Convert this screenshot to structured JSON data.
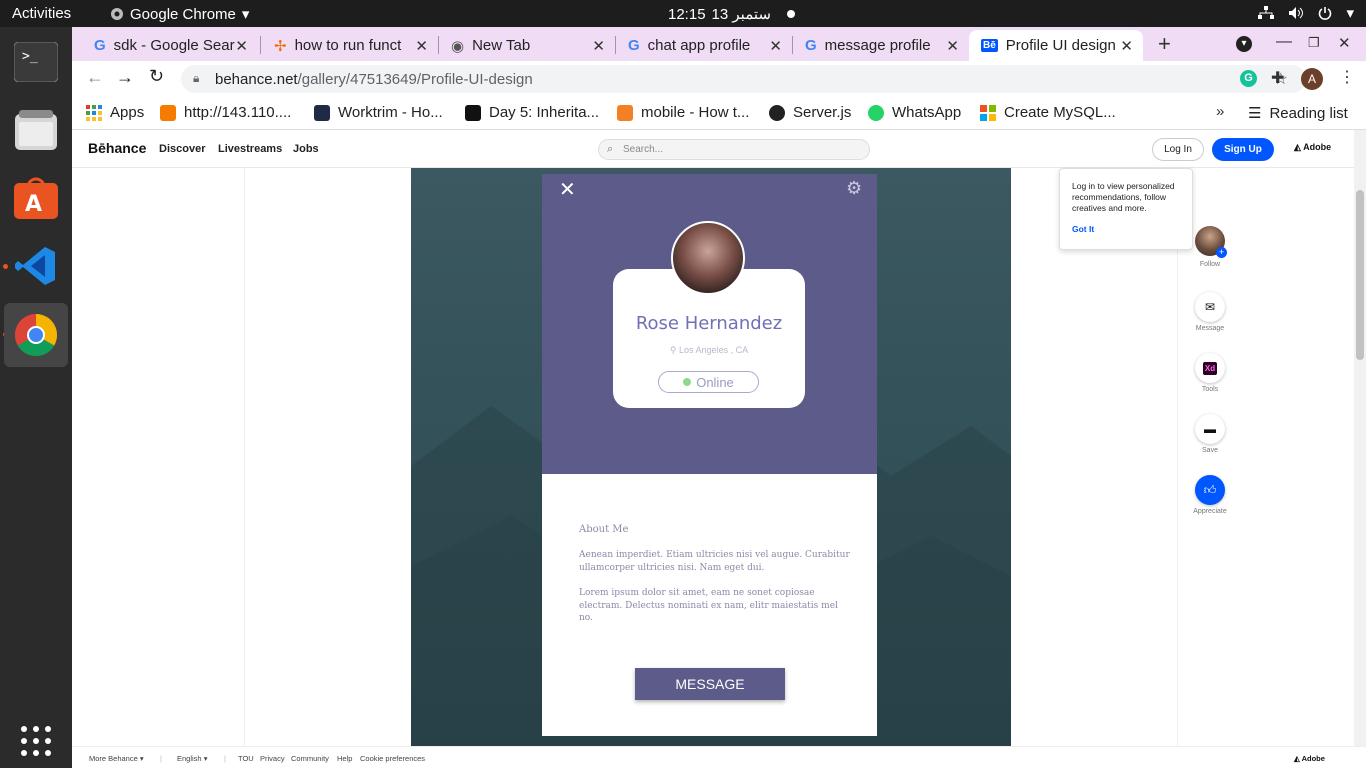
{
  "topbar": {
    "activities": "Activities",
    "app_name": "Google Chrome",
    "time": "12:15",
    "date": "13 ستمبر"
  },
  "dock": {
    "items": [
      "terminal-icon",
      "files-icon",
      "software-icon",
      "vscode-icon",
      "chrome-icon"
    ],
    "apps_grid": "show-apps-icon"
  },
  "tabs": [
    {
      "title": "sdk - Google Sear",
      "icon": "google-icon"
    },
    {
      "title": "how to run funct",
      "icon": "pinwheel-icon"
    },
    {
      "title": "New Tab",
      "icon": "chrome-icon"
    },
    {
      "title": "chat app profile",
      "icon": "google-icon"
    },
    {
      "title": "message profile",
      "icon": "google-icon"
    },
    {
      "title": "Profile UI design",
      "icon": "behance-icon"
    }
  ],
  "omnibox": {
    "domain": "behance.net",
    "path": "/gallery/47513649/Profile-UI-design"
  },
  "profile_initial": "A",
  "bookmarks": [
    {
      "label": "Apps",
      "color": "#e53935"
    },
    {
      "label": "http://143.110....",
      "color": "#f57c00"
    },
    {
      "label": "Worktrim - Ho...",
      "color": "#1f2a44"
    },
    {
      "label": "Day 5: Inherita...",
      "color": "#111111"
    },
    {
      "label": "mobile - How t...",
      "color": "#f48024"
    },
    {
      "label": "Server.js",
      "color": "#222222"
    },
    {
      "label": "WhatsApp",
      "color": "#25d366"
    },
    {
      "label": "Create MySQL...",
      "color": "#7cbb00"
    }
  ],
  "reading_list": "Reading list",
  "behance": {
    "logo": "Bēhance",
    "nav": [
      "Discover",
      "Livestreams",
      "Jobs"
    ],
    "search_placeholder": "Search...",
    "login": "Log In",
    "signup": "Sign Up",
    "adobe": "Adobe"
  },
  "tooltip": {
    "text": "Log in to view personalized recommendations, follow creatives and more.",
    "action": "Got It"
  },
  "rail": [
    {
      "label": "Follow",
      "icon": "avatar-icon"
    },
    {
      "label": "Message",
      "icon": "mail-icon"
    },
    {
      "label": "Tools",
      "icon": "xd-icon",
      "glyph": "Xd"
    },
    {
      "label": "Save",
      "icon": "folder-icon"
    },
    {
      "label": "Appreciate",
      "icon": "thumbs-up-icon"
    }
  ],
  "phone": {
    "name": "Rose Hernandez",
    "location": "Los Angeles , CA",
    "status": "Online",
    "about_title": "About Me",
    "about_p1": " Aenean imperdiet. Etiam ultricies nisi vel augue. Curabitur ullamcorper ultricies nisi. Nam eget dui.",
    "about_p2": "Lorem ipsum dolor sit amet, eam ne sonet copiosae electram. Delectus nominati ex nam, elitr maiestatis mel no.",
    "button": "MESSAGE"
  },
  "footer": {
    "more": "More Behance",
    "lang": "English",
    "links": [
      "TOU",
      "Privacy",
      "Community",
      "Help",
      "Cookie preferences"
    ],
    "adobe": "Adobe"
  },
  "colors": {
    "phone_purple": "#5c5b8a",
    "behance_blue": "#0057ff",
    "tab_strip": "#f1dcf5"
  }
}
